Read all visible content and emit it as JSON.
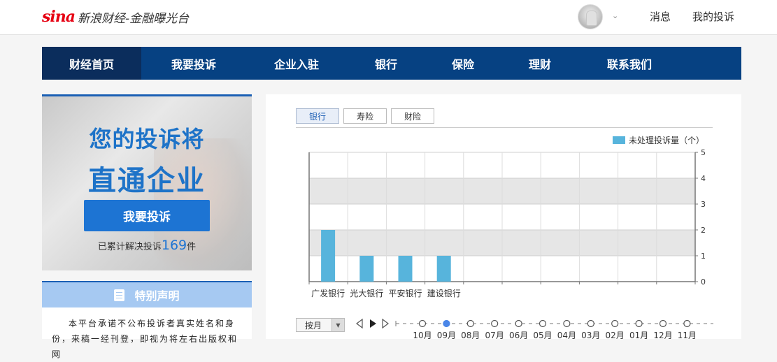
{
  "header": {
    "logo_brand": "sina",
    "logo_text": "新浪财经-金融曝光台",
    "messages_label": "消息",
    "my_complaints_label": "我的投诉"
  },
  "nav": {
    "items": [
      {
        "label": "财经首页"
      },
      {
        "label": "我要投诉"
      },
      {
        "label": "企业入驻"
      },
      {
        "label": "银行"
      },
      {
        "label": "保险"
      },
      {
        "label": "理财"
      },
      {
        "label": "联系我们"
      }
    ]
  },
  "banner": {
    "line1": "您的投诉将",
    "line2": "直通企业",
    "button_label": "我要投诉",
    "count_prefix": "已累计解决投诉",
    "count_value": "169",
    "count_suffix": "件"
  },
  "notice": {
    "title": "特别声明",
    "text": "本平台承诺不公布投诉者真实姓名和身份，来稿一经刊登，即视为将左右出版权和网"
  },
  "chart_tabs": [
    {
      "label": "银行",
      "active": true
    },
    {
      "label": "寿险",
      "active": false
    },
    {
      "label": "财险",
      "active": false
    }
  ],
  "chart_data": {
    "type": "bar",
    "categories": [
      "广发银行",
      "光大银行",
      "平安银行",
      "建设银行",
      "",
      "",
      "",
      "",
      "",
      ""
    ],
    "series": [
      {
        "name": "未处理投诉量（个）",
        "values": [
          2,
          1,
          1,
          1,
          0,
          0,
          0,
          0,
          0,
          0
        ],
        "color": "#57b4dc"
      }
    ],
    "ylim": [
      0,
      5
    ],
    "yticks": [
      "0",
      "1",
      "2",
      "3",
      "4",
      "5"
    ],
    "y_axis_side": "right",
    "grid": true,
    "legend_position": "top-right"
  },
  "timeline": {
    "period_label": "按月",
    "months": [
      "10月",
      "09月",
      "08月",
      "07月",
      "06月",
      "05月",
      "04月",
      "03月",
      "02月",
      "01月",
      "12月",
      "11月"
    ],
    "selected_index": 1
  }
}
